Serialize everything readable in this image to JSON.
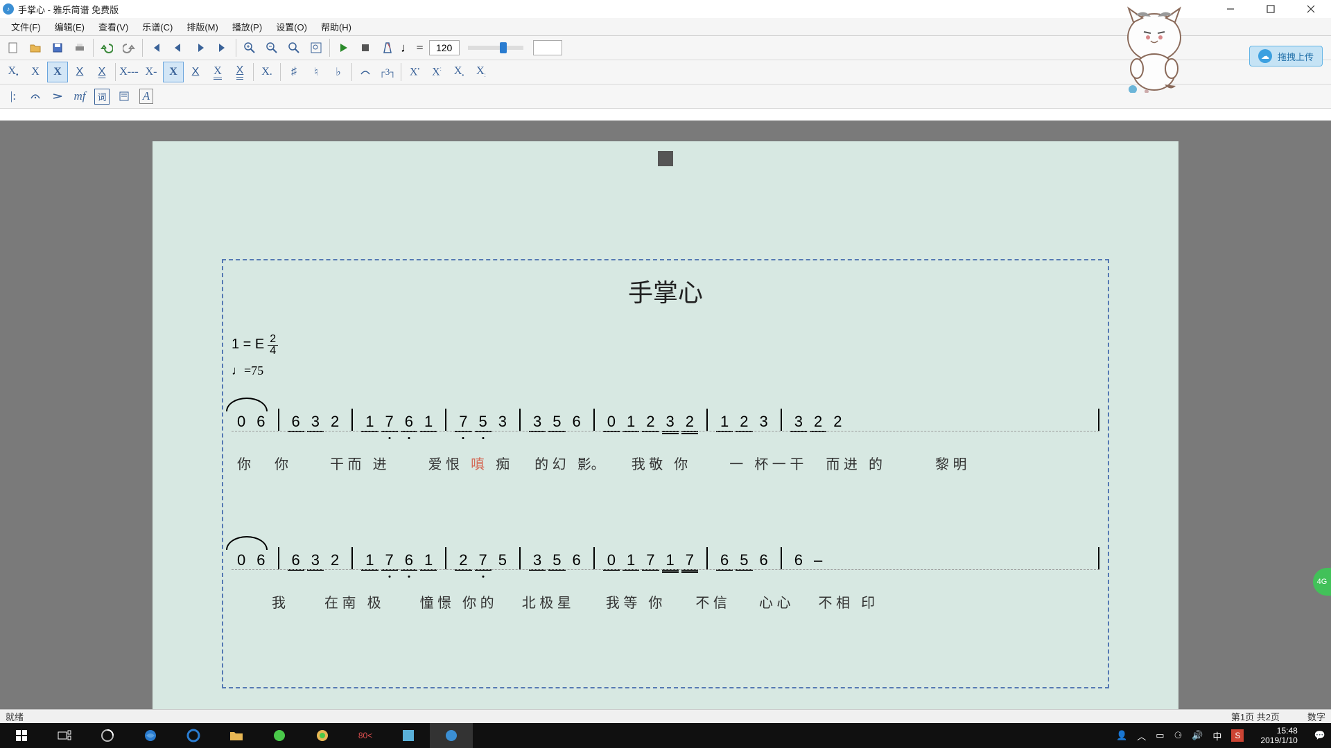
{
  "window": {
    "title": "手掌心 - 雅乐简谱 免费版"
  },
  "menus": [
    "文件(F)",
    "编辑(E)",
    "查看(V)",
    "乐谱(C)",
    "排版(M)",
    "播放(P)",
    "设置(O)",
    "帮助(H)"
  ],
  "playback": {
    "tempo": "120"
  },
  "upload": {
    "label": "拖拽上传"
  },
  "score": {
    "title": "手掌心",
    "key_prefix": "1 = E",
    "timesig_num": "2",
    "timesig_den": "4",
    "tempo_marking": "♩=75",
    "line1": {
      "notes": [
        "0",
        "6",
        "|",
        "6",
        "3",
        "2",
        "|",
        "1",
        "7",
        "6",
        "1",
        "|",
        "7",
        "5",
        "3",
        "|",
        "3",
        "5",
        "6",
        "|",
        "0",
        "1",
        "2",
        "3",
        "2",
        "|",
        "1",
        "2",
        "3",
        "|",
        "3",
        "2",
        "2",
        "|"
      ],
      "lyrics": [
        "你",
        "你",
        "",
        "干 而",
        "进",
        "",
        "爱 恨",
        "嗔",
        "痴",
        "",
        "的 幻",
        "影。",
        "",
        "我 敬",
        "你",
        "",
        "一",
        "杯 一 干",
        "",
        "而 进",
        "的",
        "",
        "",
        "黎 明",
        ""
      ]
    },
    "line2": {
      "notes": [
        "0",
        "6",
        "|",
        "6",
        "3",
        "2",
        "|",
        "1",
        "7",
        "6",
        "1",
        "|",
        "2",
        "7",
        "5",
        "|",
        "3",
        "5",
        "6",
        "|",
        "0",
        "1",
        "7",
        "1",
        "7",
        "|",
        "6",
        "5",
        "6",
        "|",
        "6",
        "–",
        "|"
      ],
      "lyrics": [
        "",
        "我",
        "",
        "在 南",
        "极",
        "",
        "憧 憬",
        "你 的",
        "",
        "北 极 星",
        "",
        "我 等",
        "你",
        "",
        "不 信",
        "",
        "心 心",
        "",
        "不 相",
        "印",
        "",
        "",
        ""
      ]
    }
  },
  "status": {
    "ready": "就绪",
    "pages": "第1页 共2页",
    "numlock": "数字"
  },
  "taskbar": {
    "time": "15:48",
    "date": "2019/1/10",
    "ime1": "中",
    "ime2": "S"
  },
  "float": {
    "label": "4G"
  }
}
